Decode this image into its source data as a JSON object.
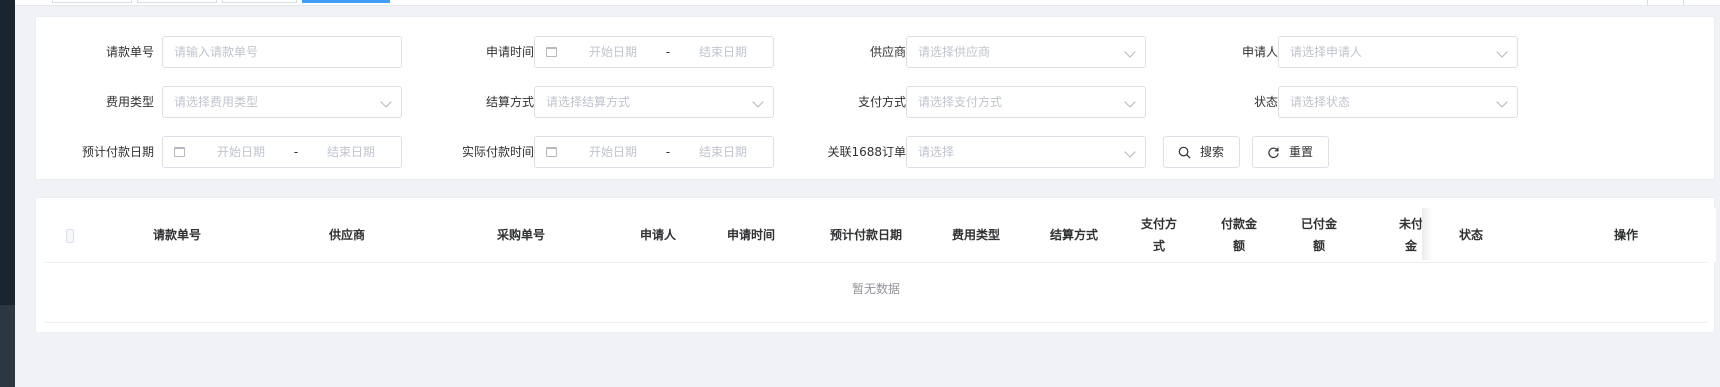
{
  "search_form": {
    "row1": {
      "request_no": {
        "label": "请款单号",
        "placeholder": "请输入请款单号"
      },
      "apply_time": {
        "label": "申请时间",
        "start": "开始日期",
        "sep": "-",
        "end": "结束日期"
      },
      "supplier": {
        "label": "供应商",
        "placeholder": "请选择供应商"
      },
      "applicant": {
        "label": "申请人",
        "placeholder": "请选择申请人"
      }
    },
    "row2": {
      "fee_type": {
        "label": "费用类型",
        "placeholder": "请选择费用类型"
      },
      "settlement": {
        "label": "结算方式",
        "placeholder": "请选择结算方式"
      },
      "payment_method": {
        "label": "支付方式",
        "placeholder": "请选择支付方式"
      },
      "status": {
        "label": "状态",
        "placeholder": "请选择状态"
      }
    },
    "row3": {
      "planned_pay_date": {
        "label": "预计付款日期",
        "start": "开始日期",
        "sep": "-",
        "end": "结束日期"
      },
      "actual_pay_time": {
        "label": "实际付款时间",
        "start": "开始日期",
        "sep": "-",
        "end": "结束日期"
      },
      "order_1688": {
        "label": "关联1688订单",
        "placeholder": "请选择"
      }
    },
    "buttons": {
      "search": "搜索",
      "reset": "重置"
    }
  },
  "table": {
    "columns": {
      "request_no": "请款单号",
      "supplier": "供应商",
      "purchase_no": "采购单号",
      "applicant": "申请人",
      "apply_time": "申请时间",
      "planned_pay_date": "预计付款日期",
      "fee_type": "费用类型",
      "settlement": "结算方式",
      "payment_method_l1": "支付方",
      "payment_method_l2": "式",
      "pay_amount_l1": "付款金",
      "pay_amount_l2": "额",
      "paid_amount_l1": "已付金",
      "paid_amount_l2": "额",
      "unpaid_partial_l1": "未付",
      "unpaid_partial_l2": "金",
      "status": "状态",
      "actions": "操作"
    },
    "empty_text": "暂无数据"
  }
}
